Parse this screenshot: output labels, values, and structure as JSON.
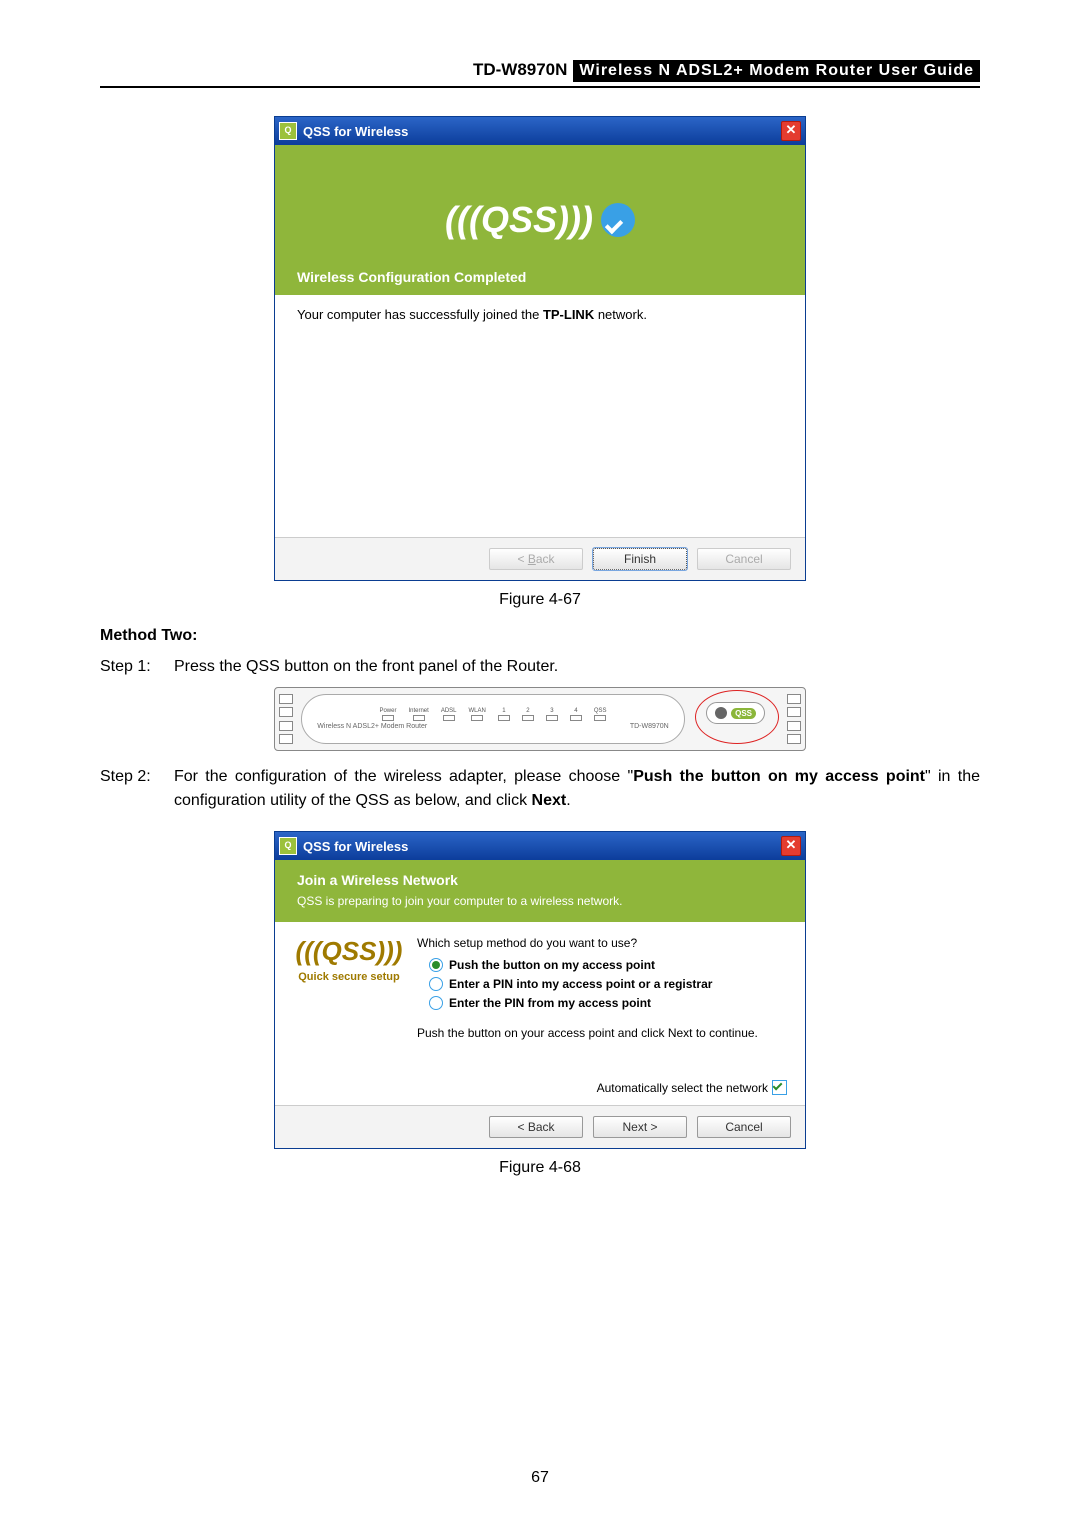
{
  "header": {
    "model": "TD-W8970N",
    "desc": "Wireless N ADSL2+ Modem Router User Guide"
  },
  "fig67": {
    "caption": "Figure 4-67",
    "window_title": "QSS for Wireless",
    "logo_text": "QSS",
    "completed_title": "Wireless Configuration Completed",
    "completed_msg_pre": "Your computer has successfully joined the ",
    "completed_msg_bold": "TP-LINK",
    "completed_msg_post": " network.",
    "btn_back": "< Back",
    "btn_finish": "Finish",
    "btn_cancel": "Cancel"
  },
  "method_two": {
    "title": "Method Two:",
    "step1_label": "Step 1:",
    "step1_text": "Press the QSS button on the front panel of the Router.",
    "step2_label": "Step 2:",
    "step2_text_a": "For the configuration of the wireless adapter, please choose \"",
    "step2_text_b_bold": "Push the button on my access point",
    "step2_text_c": "\" in the configuration utility of the QSS as below, and click ",
    "step2_text_d_bold": "Next",
    "step2_text_e": "."
  },
  "router": {
    "leds": [
      "Power",
      "Internet",
      "ADSL",
      "WLAN",
      "1",
      "2",
      "3",
      "4",
      "QSS"
    ],
    "desc": "Wireless N ADSL2+ Modem Router",
    "model": "TD-W8970N",
    "qss_label": "QSS"
  },
  "fig68": {
    "caption": "Figure 4-68",
    "window_title": "QSS for Wireless",
    "join_title": "Join a Wireless Network",
    "join_sub": "QSS is preparing to join your computer to a wireless network.",
    "side_label": "Quick secure setup",
    "side_logo": "QSS",
    "question": "Which setup method do you want to use?",
    "opt1": "Push the button on my access point",
    "opt2": "Enter a PIN into my access point or a registrar",
    "opt3": "Enter the PIN from my access point",
    "helper": "Push the button on your access point and click Next to continue.",
    "auto_label": "Automatically select the network",
    "btn_back": "< Back",
    "btn_next": "Next >",
    "btn_cancel": "Cancel"
  },
  "page_number": "67"
}
